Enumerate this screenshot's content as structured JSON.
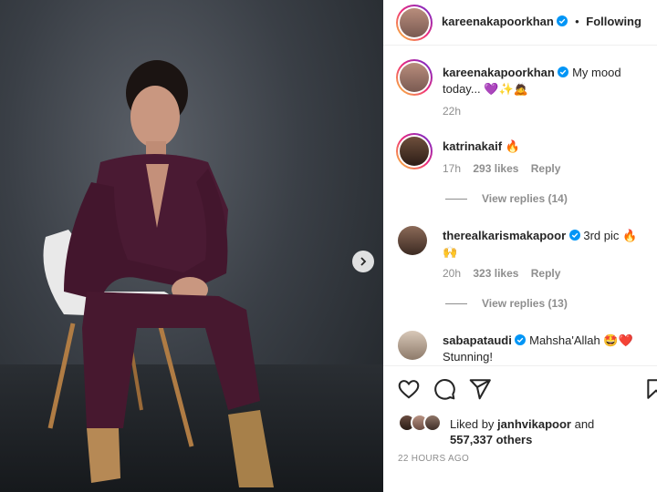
{
  "header": {
    "username": "kareenakapoorkhan",
    "separator": "•",
    "follow_status": "Following"
  },
  "caption": {
    "username": "kareenakapoorkhan",
    "text": "My mood today... 💜✨🙇",
    "time": "22h"
  },
  "comments": [
    {
      "username": "katrinakaif",
      "text": "🔥",
      "time": "17h",
      "likes": "293 likes",
      "reply": "Reply",
      "view_replies": "View replies (14)",
      "verified": false
    },
    {
      "username": "therealkarismakapoor",
      "text": "3rd pic 🔥🙌",
      "time": "20h",
      "likes": "323 likes",
      "reply": "Reply",
      "view_replies": "View replies (13)",
      "verified": true
    },
    {
      "username": "sabapataudi",
      "text": "Mahsha'Allah 🤩❤️ Stunning!",
      "verified": true
    }
  ],
  "likes": {
    "prefix": "Liked by",
    "user": "janhvikapoor",
    "and": "and",
    "count": "557,337 others"
  },
  "timestamp": "22 HOURS AGO",
  "colors": {
    "suit": "#4a1a33",
    "verified": "#0095f6",
    "muted": "#8e8e8e"
  }
}
